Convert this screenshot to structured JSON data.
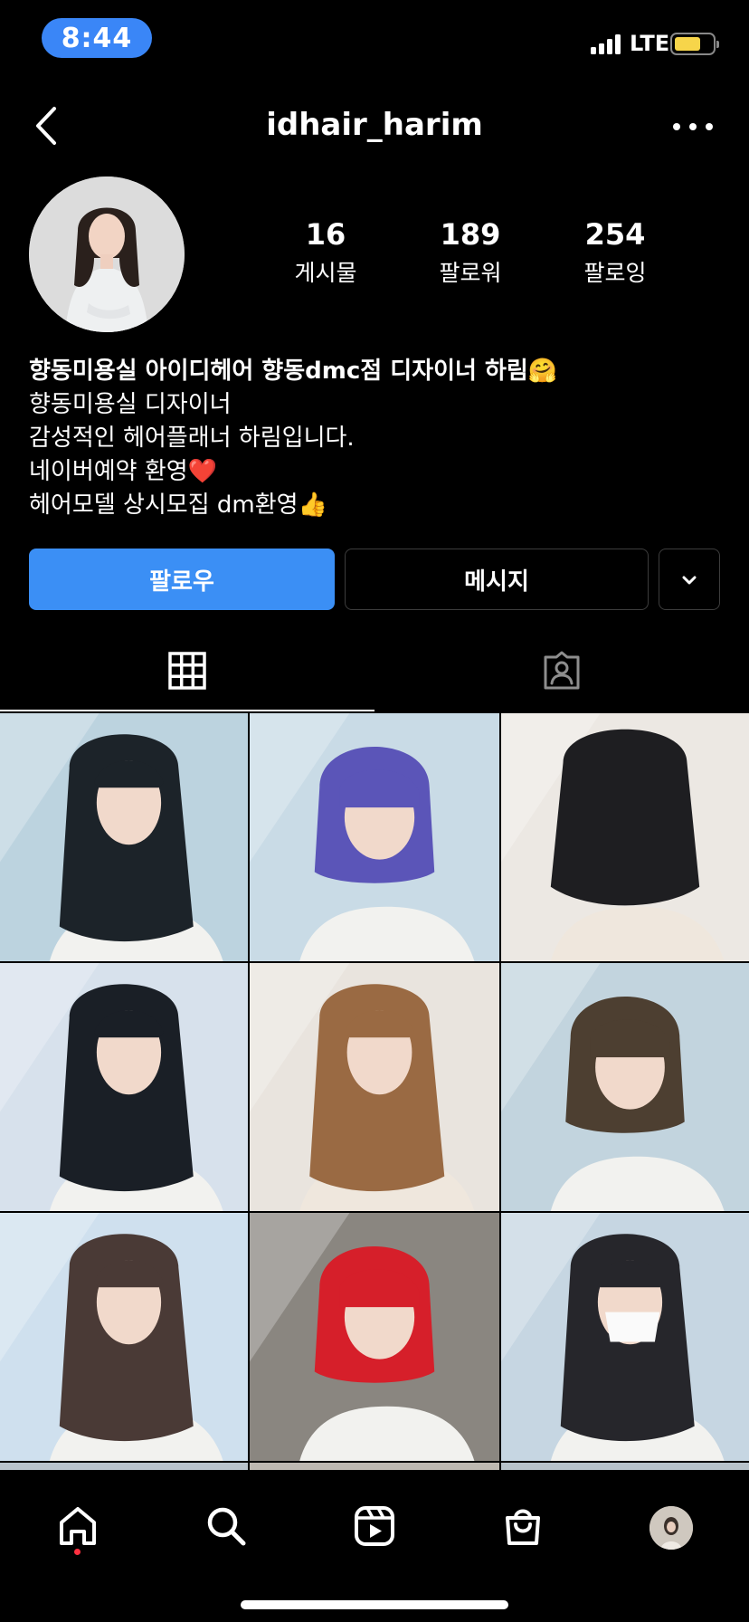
{
  "status_bar": {
    "time": "8:44",
    "network": "LTE",
    "battery_color": "#f7d54a"
  },
  "header": {
    "username": "idhair_harim",
    "back_icon": "chevron-left-icon",
    "more_icon": "more-horizontal-icon"
  },
  "profile": {
    "stats": [
      {
        "count": "16",
        "label": "게시물"
      },
      {
        "count": "189",
        "label": "팔로워"
      },
      {
        "count": "254",
        "label": "팔로잉"
      }
    ],
    "bio": {
      "name": "향동미용실 아이디헤어 향동dmc점 디자이너 하림🤗",
      "lines": [
        "향동미용실 디자이너",
        "감성적인 헤어플래너 하림입니다.",
        "네이버예약 환영❤️",
        "헤어모델 상시모집 dm환영👍"
      ]
    }
  },
  "actions": {
    "follow_label": "팔로우",
    "message_label": "메시지",
    "more_icon": "chevron-down-icon",
    "follow_color": "#3b8ff5"
  },
  "tabs": [
    {
      "name": "grid",
      "icon": "grid-icon",
      "active": true
    },
    {
      "name": "tagged",
      "icon": "tagged-user-icon",
      "active": false
    }
  ],
  "posts": [
    {
      "hair": "dark long wavy",
      "hair_color": "#1c2329"
    },
    {
      "hair": "violet bob",
      "hair_color": "#5b55b8"
    },
    {
      "hair": "dark layered back view",
      "hair_color": "#1e1e21"
    },
    {
      "hair": "dark long layered",
      "hair_color": "#1a1f26"
    },
    {
      "hair": "light brown waves",
      "hair_color": "#9a6a43"
    },
    {
      "hair": "brown bob with bangs",
      "hair_color": "#4d3f31"
    },
    {
      "hair": "brown long waves",
      "hair_color": "#4a3a36"
    },
    {
      "hair": "red bob",
      "hair_color": "#d61f2a"
    },
    {
      "hair": "dark waves with mask",
      "hair_color": "#26262b"
    }
  ],
  "bottom_nav": [
    {
      "name": "home",
      "icon": "home-icon"
    },
    {
      "name": "search",
      "icon": "search-icon"
    },
    {
      "name": "reels",
      "icon": "reels-icon"
    },
    {
      "name": "shop",
      "icon": "shop-bag-icon"
    },
    {
      "name": "profile",
      "icon": "profile-avatar-icon"
    }
  ]
}
